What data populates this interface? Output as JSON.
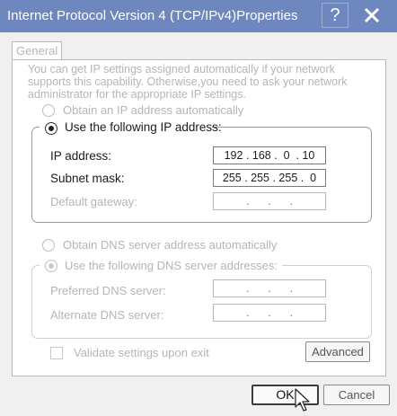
{
  "window": {
    "title": "Internet Protocol Version 4 (TCP/IPv4)Properties",
    "help_label": "?",
    "close_icon": "close-icon"
  },
  "tabs": [
    {
      "label": "General"
    }
  ],
  "description": "You can get IP settings assigned automatically if your network supports this capability. Otherwise,you need to ask your network administrator for the appropriate IP settings.",
  "ip_section": {
    "auto_option": "Obtain an IP address automatically",
    "manual_option": "Use the following IP address:",
    "selected": "manual",
    "fields": [
      {
        "label": "IP address:",
        "value": "192 . 168 .  0  . 10"
      },
      {
        "label": "Subnet mask:",
        "value": "255 . 255 . 255 .  0"
      },
      {
        "label": "Default gateway:",
        "value": ".      .      ."
      }
    ]
  },
  "dns_section": {
    "auto_option": "Obtain DNS  server address automatically",
    "manual_option": "Use the following DNS server addresses:",
    "selected": "manual",
    "fields": [
      {
        "label": "Preferred DNS server:",
        "value": ".      .      ."
      },
      {
        "label": "Alternate DNS server:",
        "value": ".      .      ."
      }
    ]
  },
  "validate": {
    "label": "Validate settings upon exit",
    "checked": false
  },
  "buttons": {
    "advanced": "Advanced",
    "ok": "OK",
    "cancel": "Cancel"
  },
  "colors": {
    "titlebar": "#6e87bf",
    "disabled_text": "#b5b5b5"
  },
  "icons": {
    "cursor": "mouse-pointer-icon"
  }
}
